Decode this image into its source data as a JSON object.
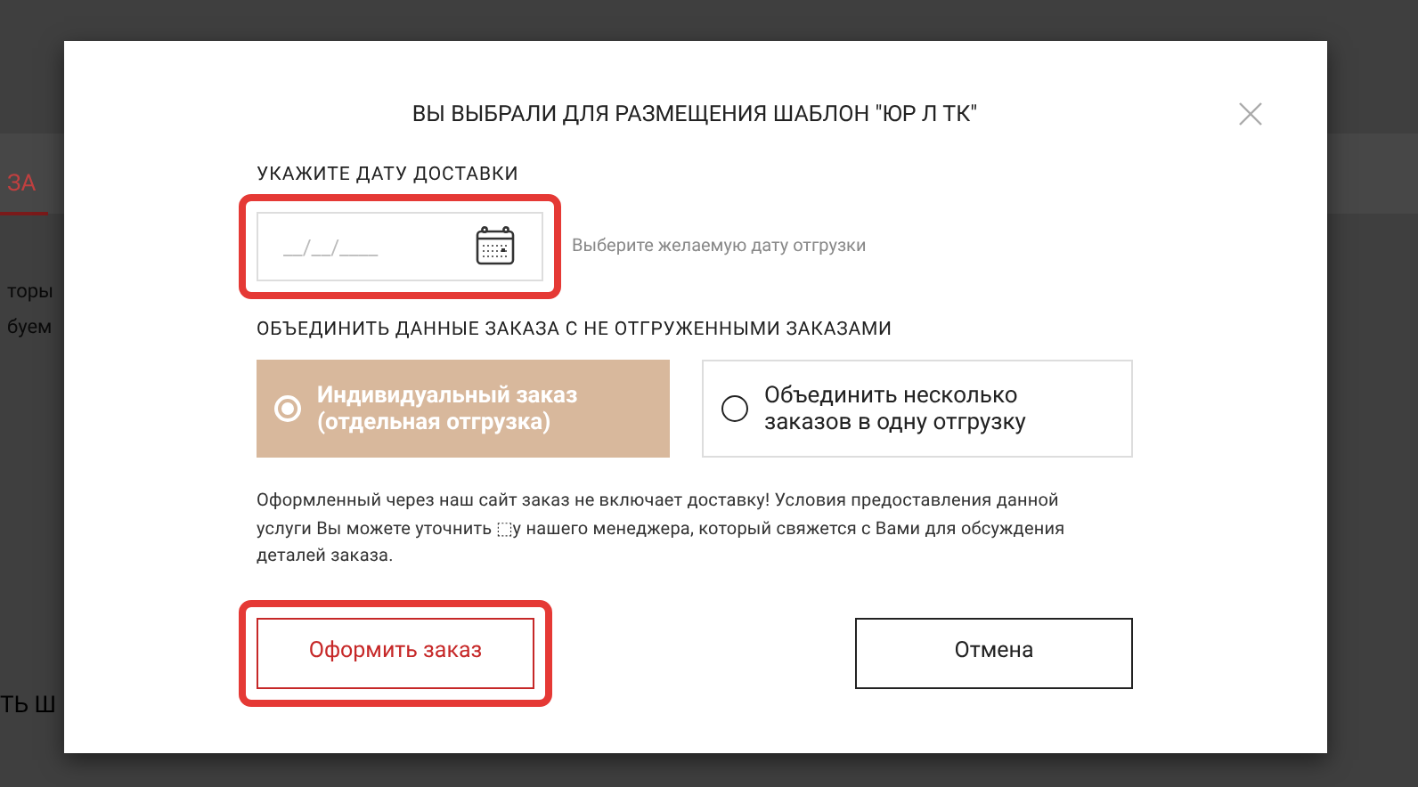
{
  "background": {
    "tab": "ЗА",
    "texts": [
      "торы",
      "буем"
    ],
    "section_title": "ТЬ Ш"
  },
  "dialog": {
    "title": "ВЫ ВЫБРАЛИ ДЛЯ РАЗМЕЩЕНИЯ ШАБЛОН \"ЮР Л ТК\"",
    "date_label": "УКАЖИТЕ ДАТУ ДОСТАВКИ",
    "date_field": {
      "placeholder": "__/__/____",
      "highlighted": true
    },
    "date_hint": "Выберите желаемую дату отгрузки",
    "merge_label": "ОБЪЕДИНИТЬ ДАННЫЕ ЗАКАЗА С НЕ ОТГРУЖЕННЫМИ ЗАКАЗАМИ",
    "options": [
      {
        "label": "Индивидуальный заказ (отдельная отгрузка)",
        "selected": true
      },
      {
        "label": "Объединить несколько заказов в одну отгрузку",
        "selected": false
      }
    ],
    "notice": "Оформленный через наш сайт заказ не включает доставку! Условия предоставления данной услуги Вы можете уточнить ⬚у нашего менеджера, который свяжется с Вами для обсуждения деталей заказа.",
    "buttons": [
      {
        "label": "Оформить заказ",
        "kind": "primary",
        "highlighted": true
      },
      {
        "label": "Отмена",
        "kind": "secondary",
        "highlighted": false
      }
    ]
  }
}
